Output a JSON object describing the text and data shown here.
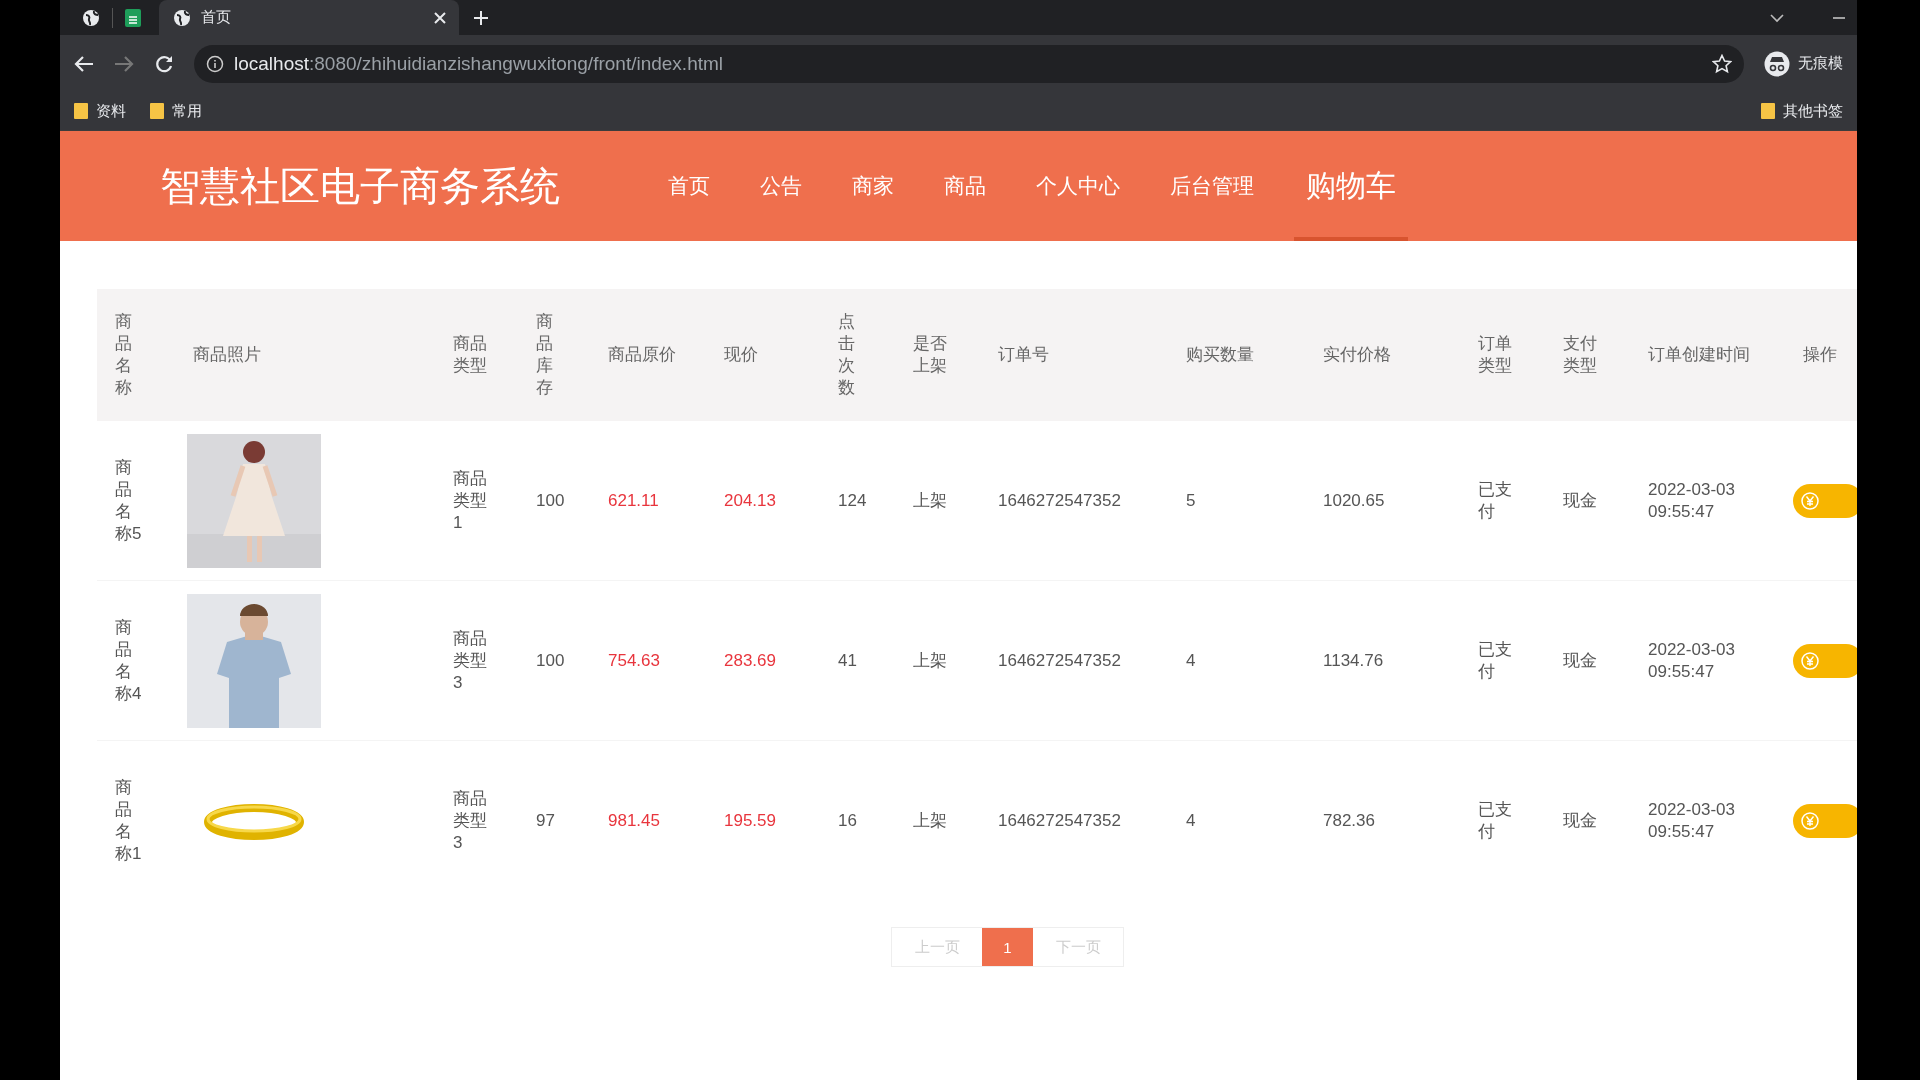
{
  "browser": {
    "tabs": [
      {
        "title": "首页",
        "selected": true
      }
    ],
    "address": {
      "host": "localhost",
      "path": ":8080/zhihuidianzishangwuxitong/front/index.html"
    },
    "profile_label": "无痕模",
    "bookmarks": [
      "资料",
      "常用"
    ],
    "other_bookmarks": "其他书签"
  },
  "site": {
    "title": "智慧社区电子商务系统",
    "nav": [
      {
        "label": "首页",
        "selected": false
      },
      {
        "label": "公告",
        "selected": false
      },
      {
        "label": "商家",
        "selected": false
      },
      {
        "label": "商品",
        "selected": false
      },
      {
        "label": "个人中心",
        "selected": false
      },
      {
        "label": "后台管理",
        "selected": false
      },
      {
        "label": "购物车",
        "selected": true
      }
    ]
  },
  "table": {
    "columns": [
      "商品名称",
      "商品照片",
      "商品类型",
      "商品库存",
      "商品原价",
      "现价",
      "点击次数",
      "是否上架",
      "订单号",
      "购买数量",
      "实付价格",
      "订单类型",
      "支付类型",
      "订单创建时间",
      "操作"
    ],
    "rows": [
      {
        "name": "商品名称5",
        "type": "商品类型1",
        "stock": "100",
        "original_price": "621.11",
        "price": "204.13",
        "clicks": "124",
        "listed": "上架",
        "order_no": "1646272547352",
        "quantity": "5",
        "paid": "1020.65",
        "order_type": "已支付",
        "pay_type": "现金",
        "created": "2022-03-03 09:55:47"
      },
      {
        "name": "商品名称4",
        "type": "商品类型3",
        "stock": "100",
        "original_price": "754.63",
        "price": "283.69",
        "clicks": "41",
        "listed": "上架",
        "order_no": "1646272547352",
        "quantity": "4",
        "paid": "1134.76",
        "order_type": "已支付",
        "pay_type": "现金",
        "created": "2022-03-03 09:55:47"
      },
      {
        "name": "商品名称1",
        "type": "商品类型3",
        "stock": "97",
        "original_price": "981.45",
        "price": "195.59",
        "clicks": "16",
        "listed": "上架",
        "order_no": "1646272547352",
        "quantity": "4",
        "paid": "782.36",
        "order_type": "已支付",
        "pay_type": "现金",
        "created": "2022-03-03 09:55:47"
      }
    ]
  },
  "pagination": {
    "prev": {
      "label": "上一页",
      "disabled": true
    },
    "pages": [
      {
        "label": "1",
        "selected": true
      }
    ],
    "next": {
      "label": "下一页",
      "disabled": true
    }
  }
}
